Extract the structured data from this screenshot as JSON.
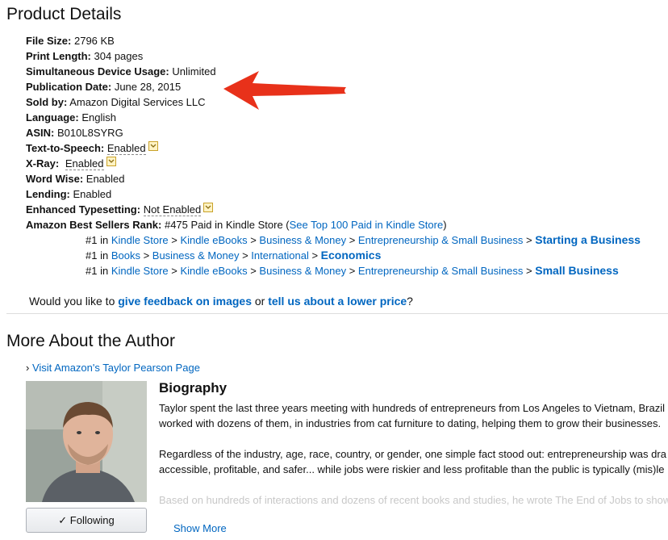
{
  "product_details": {
    "heading": "Product Details",
    "file_size": {
      "label": "File Size:",
      "value": "2796 KB"
    },
    "print_length": {
      "label": "Print Length:",
      "value": "304 pages"
    },
    "device_usage": {
      "label": "Simultaneous Device Usage:",
      "value": "Unlimited"
    },
    "publication_date": {
      "label": "Publication Date:",
      "value": "June 28, 2015"
    },
    "sold_by": {
      "label": "Sold by:",
      "value": "Amazon Digital Services LLC"
    },
    "language": {
      "label": "Language:",
      "value": "English"
    },
    "asin": {
      "label": "ASIN:",
      "value": "B010L8SYRG"
    },
    "text_to_speech": {
      "label": "Text-to-Speech:",
      "value": "Enabled"
    },
    "xray": {
      "label": "X-Ray:",
      "value": "Enabled"
    },
    "word_wise": {
      "label": "Word Wise:",
      "value": "Enabled"
    },
    "lending": {
      "label": "Lending:",
      "value": "Enabled"
    },
    "enhanced_typesetting": {
      "label": "Enhanced Typesetting:",
      "value": "Not Enabled"
    },
    "best_sellers": {
      "label": "Amazon Best Sellers Rank:",
      "main_rank": "#475 Paid in Kindle Store (",
      "see_top": "See Top 100 Paid in Kindle Store",
      "close_paren": ")",
      "rankings": [
        {
          "rank": "#1",
          "path": [
            "Kindle Store",
            "Kindle eBooks",
            "Business & Money",
            "Entrepreneurship & Small Business"
          ],
          "leaf": "Starting a Business"
        },
        {
          "rank": "#1",
          "path": [
            "Books",
            "Business & Money",
            "International"
          ],
          "leaf": "Economics"
        },
        {
          "rank": "#1",
          "path": [
            "Kindle Store",
            "Kindle eBooks",
            "Business & Money",
            "Entrepreneurship & Small Business"
          ],
          "leaf": "Small Business"
        }
      ]
    },
    "feedback": {
      "prefix": "Would you like to",
      "images_link": "give feedback on images",
      "or": "or",
      "price_link": "tell us about a lower price",
      "suffix": "?"
    }
  },
  "author": {
    "heading": "More About the Author",
    "visit_link": "Visit Amazon's Taylor Pearson Page",
    "follow_label": "Following",
    "bio_title": "Biography",
    "bio_p1_l1": "Taylor spent the last three years meeting with hundreds of entrepreneurs from Los Angeles to Vietnam, Brazil",
    "bio_p1_l2": "worked with dozens of them, in industries from cat furniture to dating, helping them to grow their businesses.",
    "bio_p2_l1": "Regardless of the industry, age, race, country, or gender, one simple fact stood out: entrepreneurship was dra",
    "bio_p2_l2": "accessible, profitable, and safer... while jobs were riskier and less profitable than the public is typically (mis)le",
    "bio_p3_l1": "Based on hundreds of interactions and dozens of recent books and studies, he wrote The End of Jobs to show",
    "show_more": "Show More"
  },
  "colors": {
    "link": "#0066c0",
    "arrow": "#e8311a"
  }
}
